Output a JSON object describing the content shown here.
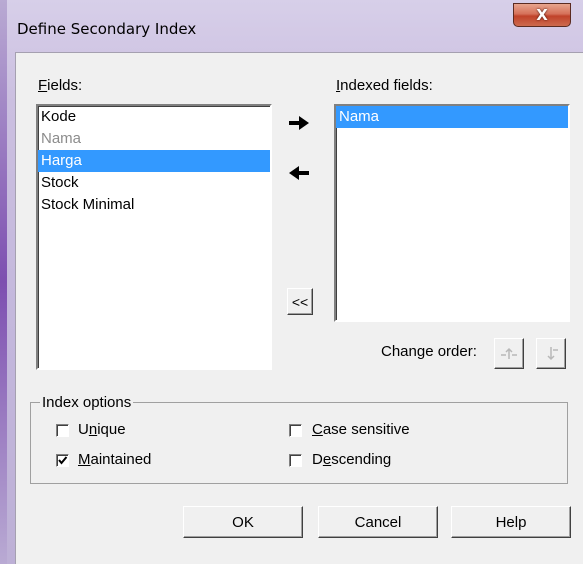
{
  "window": {
    "title": "Define Secondary Index",
    "close_glyph": "X"
  },
  "fields": {
    "label_accel": "F",
    "label_rest": "ields:",
    "items": [
      {
        "label": "Kode",
        "state": "normal"
      },
      {
        "label": "Nama",
        "state": "disabled"
      },
      {
        "label": "Harga",
        "state": "selected"
      },
      {
        "label": "Stock",
        "state": "normal"
      },
      {
        "label": "Stock Minimal",
        "state": "normal"
      }
    ]
  },
  "indexed_fields": {
    "label_accel": "I",
    "label_rest": "ndexed fields:",
    "items": [
      {
        "label": "Nama",
        "state": "selected"
      }
    ]
  },
  "transfer": {
    "add_icon": "arrow-right-icon",
    "remove_icon": "arrow-left-icon",
    "remove_all_label": "<<"
  },
  "change_order": {
    "label": "Change order:",
    "up_icon": "move-up-icon",
    "down_icon": "move-down-icon"
  },
  "index_options": {
    "title": "Index options",
    "unique": {
      "pre": "U",
      "accel": "n",
      "post": "ique",
      "checked": false
    },
    "maintained": {
      "pre": "",
      "accel": "M",
      "post": "aintained",
      "checked": true
    },
    "case_sensitive": {
      "pre": "",
      "accel": "C",
      "post": "ase sensitive",
      "checked": false
    },
    "descending": {
      "pre": "D",
      "accel": "e",
      "post": "scending",
      "checked": false
    }
  },
  "buttons": {
    "ok": "OK",
    "cancel": "Cancel",
    "help": "Help"
  },
  "colors": {
    "selection": "#3399ff",
    "frame": "#c3b7dc",
    "close_button": "#c0422a"
  }
}
